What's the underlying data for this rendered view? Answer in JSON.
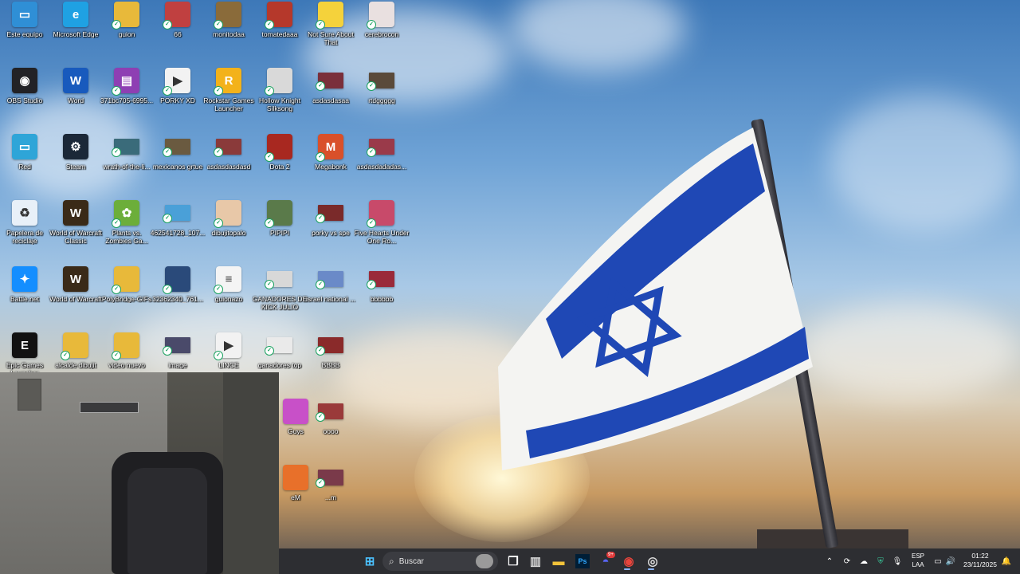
{
  "desktop": {
    "icons": [
      {
        "label": "Este equipo",
        "icon": "computer-icon",
        "color": "#2f8fd6",
        "glyph": "▭",
        "col": 0,
        "row": 0,
        "check": false
      },
      {
        "label": "Microsoft Edge",
        "icon": "edge-icon",
        "color": "#1fa1e3",
        "glyph": "e",
        "col": 1,
        "row": 0,
        "check": false
      },
      {
        "label": "guion",
        "icon": "folder-icon",
        "color": "#e8b93a",
        "glyph": "",
        "col": 2,
        "row": 0,
        "check": true
      },
      {
        "label": "66",
        "icon": "image-thumbnail-icon",
        "color": "#c04040",
        "glyph": "",
        "col": 3,
        "row": 0,
        "check": true
      },
      {
        "label": "monitodaa",
        "icon": "image-thumbnail-icon",
        "color": "#8a6b3a",
        "glyph": "",
        "col": 4,
        "row": 0,
        "check": true
      },
      {
        "label": "tomatedaaa",
        "icon": "image-thumbnail-icon",
        "color": "#b5382b",
        "glyph": "",
        "col": 5,
        "row": 0,
        "check": true
      },
      {
        "label": "Not Sure About That",
        "icon": "duck-icon",
        "color": "#f5d23b",
        "glyph": "",
        "col": 6,
        "row": 0,
        "check": true
      },
      {
        "label": "cerebrocon",
        "icon": "image-thumbnail-icon",
        "color": "#e9e0e0",
        "glyph": "",
        "col": 7,
        "row": 0,
        "check": true
      },
      {
        "label": "OBS Studio",
        "icon": "obs-icon",
        "color": "#222226",
        "glyph": "◉",
        "col": 0,
        "row": 1,
        "check": false
      },
      {
        "label": "Word",
        "icon": "word-icon",
        "color": "#185abd",
        "glyph": "W",
        "col": 1,
        "row": 1,
        "check": false
      },
      {
        "label": "371bc705-6995...",
        "icon": "archive-icon",
        "color": "#8e3fb3",
        "glyph": "▤",
        "col": 2,
        "row": 1,
        "check": true
      },
      {
        "label": "PORKY XD",
        "icon": "video-file-icon",
        "color": "#f2f2f2",
        "glyph": "▶",
        "col": 3,
        "row": 1,
        "check": true
      },
      {
        "label": "Rockstar Games Launcher",
        "icon": "rockstar-icon",
        "color": "#f3b21a",
        "glyph": "R",
        "col": 4,
        "row": 1,
        "check": true
      },
      {
        "label": "Hollow Knight Silksong",
        "icon": "hollow-knight-icon",
        "color": "#d9d9d9",
        "glyph": "",
        "col": 5,
        "row": 1,
        "check": true
      },
      {
        "label": "asdasdasaa",
        "icon": "video-thumbnail-icon",
        "color": "#7a2f3b",
        "glyph": "",
        "col": 6,
        "row": 1,
        "check": true,
        "thumb": true
      },
      {
        "label": "rtdggggg",
        "icon": "video-thumbnail-icon",
        "color": "#5a4a3a",
        "glyph": "",
        "col": 7,
        "row": 1,
        "check": true,
        "thumb": true
      },
      {
        "label": "Red",
        "icon": "network-icon",
        "color": "#2ea5d8",
        "glyph": "▭",
        "col": 0,
        "row": 2,
        "check": false
      },
      {
        "label": "Steam",
        "icon": "steam-icon",
        "color": "#1b2838",
        "glyph": "⚙",
        "col": 1,
        "row": 2,
        "check": false
      },
      {
        "label": "wrath-of-the-li...",
        "icon": "video-thumbnail-icon",
        "color": "#3a6b7a",
        "glyph": "",
        "col": 2,
        "row": 2,
        "check": true,
        "thumb": true
      },
      {
        "label": "mexicanos grtue",
        "icon": "video-thumbnail-icon",
        "color": "#6a5a40",
        "glyph": "",
        "col": 3,
        "row": 2,
        "check": true,
        "thumb": true
      },
      {
        "label": "asdasdasdasd",
        "icon": "video-thumbnail-icon",
        "color": "#8a3a3a",
        "glyph": "",
        "col": 4,
        "row": 2,
        "check": true,
        "thumb": true
      },
      {
        "label": "Dota 2",
        "icon": "dota-icon",
        "color": "#a82820",
        "glyph": "",
        "col": 5,
        "row": 2,
        "check": true
      },
      {
        "label": "Megabonk",
        "icon": "megabonk-icon",
        "color": "#d9502a",
        "glyph": "M",
        "col": 6,
        "row": 2,
        "check": true
      },
      {
        "label": "asdasdadadas...",
        "icon": "video-thumbnail-icon",
        "color": "#9a3a4a",
        "glyph": "",
        "col": 7,
        "row": 2,
        "check": true,
        "thumb": true
      },
      {
        "label": "Papelera de reciclaje",
        "icon": "recycle-bin-icon",
        "color": "#e8f0f8",
        "glyph": "♻",
        "col": 0,
        "row": 3,
        "check": false
      },
      {
        "label": "World of Warcraft Classic",
        "icon": "wow-icon",
        "color": "#3a2a18",
        "glyph": "W",
        "col": 1,
        "row": 3,
        "check": false
      },
      {
        "label": "Plants vs. Zombies Ga...",
        "icon": "pvz-icon",
        "color": "#6cae3a",
        "glyph": "✿",
        "col": 2,
        "row": 3,
        "check": true
      },
      {
        "label": "462541728_107...",
        "icon": "image-thumbnail-icon",
        "color": "#4aa0d8",
        "glyph": "",
        "col": 3,
        "row": 3,
        "check": true,
        "thumb": true
      },
      {
        "label": "dibujitopalo",
        "icon": "image-thumbnail-icon",
        "color": "#e8c8a8",
        "glyph": "",
        "col": 4,
        "row": 3,
        "check": true
      },
      {
        "label": "PIPIPI",
        "icon": "image-thumbnail-icon",
        "color": "#5a7a4a",
        "glyph": "",
        "col": 5,
        "row": 3,
        "check": true
      },
      {
        "label": "porky vs spe",
        "icon": "video-thumbnail-icon",
        "color": "#7a2a2a",
        "glyph": "",
        "col": 6,
        "row": 3,
        "check": true,
        "thumb": true
      },
      {
        "label": "Five Hearts Under One Ro...",
        "icon": "image-thumbnail-icon",
        "color": "#c84a6a",
        "glyph": "",
        "col": 7,
        "row": 3,
        "check": true
      },
      {
        "label": "Battle.net",
        "icon": "battlenet-icon",
        "color": "#148eff",
        "glyph": "✦",
        "col": 0,
        "row": 4,
        "check": false
      },
      {
        "label": "World of Warcraft",
        "icon": "wow-icon",
        "color": "#3a2a18",
        "glyph": "W",
        "col": 1,
        "row": 4,
        "check": false
      },
      {
        "label": "PolyBridge-GIFs",
        "icon": "folder-icon",
        "color": "#e8b93a",
        "glyph": "",
        "col": 2,
        "row": 4,
        "check": true
      },
      {
        "label": "32362340_761...",
        "icon": "image-thumbnail-icon",
        "color": "#2a4a7a",
        "glyph": "",
        "col": 3,
        "row": 4,
        "check": true
      },
      {
        "label": "guionazo",
        "icon": "word-doc-icon",
        "color": "#f4f4f4",
        "glyph": "≡",
        "col": 4,
        "row": 4,
        "check": true
      },
      {
        "label": "GANADORES DE KICK JULIO",
        "icon": "image-thumbnail-icon",
        "color": "#d8d8d8",
        "glyph": "",
        "col": 5,
        "row": 4,
        "check": true,
        "thumb": true
      },
      {
        "label": "israel national ...",
        "icon": "video-thumbnail-icon",
        "color": "#6a8ac8",
        "glyph": "",
        "col": 6,
        "row": 4,
        "check": true,
        "thumb": true
      },
      {
        "label": "bbbbbb",
        "icon": "video-thumbnail-icon",
        "color": "#9a2a3a",
        "glyph": "",
        "col": 7,
        "row": 4,
        "check": true,
        "thumb": true
      },
      {
        "label": "Epic Games Launcher",
        "icon": "epic-games-icon",
        "color": "#111111",
        "glyph": "E",
        "col": 0,
        "row": 5,
        "check": false
      },
      {
        "label": "alcalde dibujit",
        "icon": "folder-icon",
        "color": "#e8b93a",
        "glyph": "",
        "col": 1,
        "row": 5,
        "check": true
      },
      {
        "label": "video nuevo",
        "icon": "folder-icon",
        "color": "#e8b93a",
        "glyph": "",
        "col": 2,
        "row": 5,
        "check": true
      },
      {
        "label": "image",
        "icon": "image-thumbnail-icon",
        "color": "#4a4a6a",
        "glyph": "",
        "col": 3,
        "row": 5,
        "check": true,
        "thumb": true
      },
      {
        "label": "LINCE",
        "icon": "video-file-icon",
        "color": "#f2f2f2",
        "glyph": "▶",
        "col": 4,
        "row": 5,
        "check": true
      },
      {
        "label": "ganadores top",
        "icon": "image-thumbnail-icon",
        "color": "#eaeaea",
        "glyph": "",
        "col": 5,
        "row": 5,
        "check": true,
        "thumb": true
      },
      {
        "label": "BBBB",
        "icon": "video-thumbnail-icon",
        "color": "#8a2a2a",
        "glyph": "",
        "col": 6,
        "row": 5,
        "check": true,
        "thumb": true
      },
      {
        "label": "Guys",
        "icon": "fall-guys-icon",
        "color": "#c850c8",
        "glyph": "",
        "col": 5,
        "row": 6,
        "check": false,
        "partial": true
      },
      {
        "label": "oooo",
        "icon": "video-thumbnail-icon",
        "color": "#9a3a3a",
        "glyph": "",
        "col": 6,
        "row": 6,
        "check": true,
        "thumb": true
      },
      {
        "label": "eM",
        "icon": "app-icon",
        "color": "#e8702a",
        "glyph": "",
        "col": 5,
        "row": 7,
        "check": false,
        "partial": true
      },
      {
        "label": "...m",
        "icon": "video-thumbnail-icon",
        "color": "#7a3a4a",
        "glyph": "",
        "col": 6,
        "row": 7,
        "check": true,
        "thumb": true
      }
    ]
  },
  "taskbar": {
    "search_placeholder": "Buscar",
    "apps": [
      {
        "name": "start-button",
        "glyph": "⊞",
        "color": "#4cc2ff"
      },
      {
        "name": "task-view-button",
        "glyph": "❐",
        "color": "#ffffff"
      },
      {
        "name": "notepad-app",
        "glyph": "▥",
        "color": "#d8d8d8"
      },
      {
        "name": "file-explorer-app",
        "glyph": "▬",
        "color": "#f3c33a"
      },
      {
        "name": "photoshop-app",
        "glyph": "Ps",
        "color": "#31a8ff"
      },
      {
        "name": "discord-app",
        "glyph": "◓",
        "color": "#5865f2"
      },
      {
        "name": "chrome-app",
        "glyph": "◉",
        "color": "#e8453c"
      },
      {
        "name": "obs-app",
        "glyph": "◎",
        "color": "#dddddd"
      }
    ],
    "discord_badge": "9+",
    "language": {
      "line1": "ESP",
      "line2": "LAA"
    },
    "clock": {
      "time": "01:22",
      "date": "23/11/2025"
    }
  }
}
